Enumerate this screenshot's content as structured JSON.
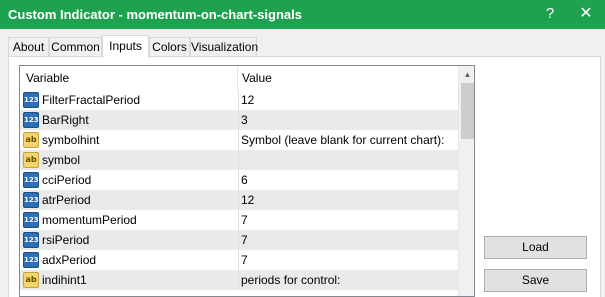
{
  "window": {
    "title": "Custom Indicator - momentum-on-chart-signals",
    "help_glyph": "?",
    "close_glyph": "✕"
  },
  "tabs": [
    {
      "label": "About"
    },
    {
      "label": "Common"
    },
    {
      "label": "Inputs",
      "active": true
    },
    {
      "label": "Colors"
    },
    {
      "label": "Visualization"
    }
  ],
  "grid": {
    "headers": {
      "variable": "Variable",
      "value": "Value"
    },
    "rows": [
      {
        "type": "number",
        "icon": "123",
        "name": "FilterFractalPeriod",
        "value": "12"
      },
      {
        "type": "number",
        "icon": "123",
        "name": "BarRight",
        "value": "3"
      },
      {
        "type": "string",
        "icon": "ab",
        "name": "symbolhint",
        "value": "Symbol (leave blank for current chart):"
      },
      {
        "type": "string",
        "icon": "ab",
        "name": "symbol",
        "value": ""
      },
      {
        "type": "number",
        "icon": "123",
        "name": "cciPeriod",
        "value": "6"
      },
      {
        "type": "number",
        "icon": "123",
        "name": "atrPeriod",
        "value": "12"
      },
      {
        "type": "number",
        "icon": "123",
        "name": "momentumPeriod",
        "value": "7"
      },
      {
        "type": "number",
        "icon": "123",
        "name": "rsiPeriod",
        "value": "7"
      },
      {
        "type": "number",
        "icon": "123",
        "name": "adxPeriod",
        "value": "7"
      },
      {
        "type": "string",
        "icon": "ab",
        "name": "indihint1",
        "value": "periods for control:"
      }
    ],
    "scroll_up_glyph": "▲"
  },
  "buttons": {
    "load": "Load",
    "save": "Save"
  },
  "colors": {
    "titlebar": "#1ea24f",
    "alt_row": "#eaeaea"
  }
}
